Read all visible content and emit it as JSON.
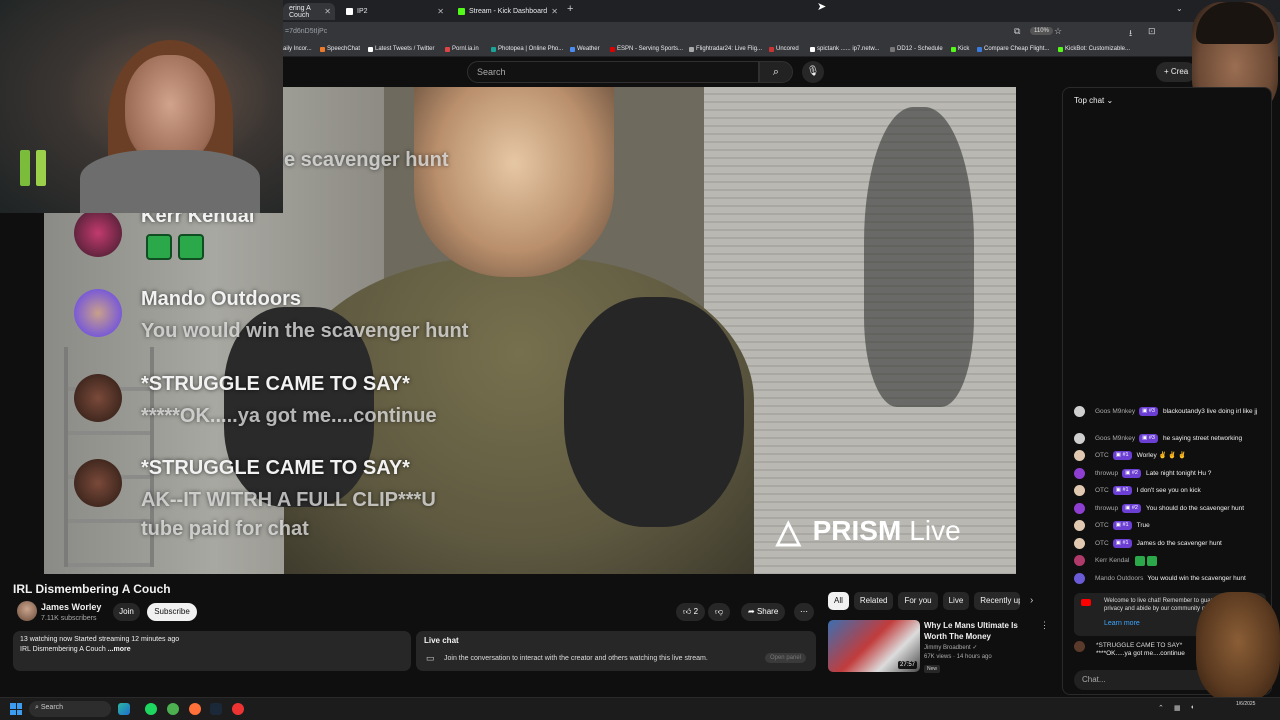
{
  "browser": {
    "tabs": [
      {
        "label": "ering A Couch",
        "active": true
      },
      {
        "label": "IP2",
        "active": false
      },
      {
        "label": "Stream - Kick Dashboard",
        "active": false
      }
    ],
    "url_fragment": "=7d6nD5tIjPc",
    "zoom": "110%",
    "bookmarks": [
      "aily Incor...",
      "SpeechChat",
      "Latest Tweets / Twitter",
      "Pornl.ia.in",
      "Photopea | Online Pho...",
      "Weather",
      "ESPN - Serving Sports...",
      "Flightradar24: Live Flig...",
      "Uncored",
      "spictank ...... ip7.netw...",
      "DD12 - Schedule",
      "Kick",
      "Compare Cheap Flight...",
      "KickBot: Customizable..."
    ]
  },
  "youtube": {
    "search_placeholder": "Search",
    "create_label": "+ Crea"
  },
  "video_overlay": {
    "scavenger_fragment": "e scavenger hunt",
    "messages": [
      {
        "name": "Kerr Kendal",
        "text": ""
      },
      {
        "name": "Mando Outdoors",
        "text": "You would win the scavenger hunt"
      },
      {
        "name": "*STRUGGLE CAME TO SAY*",
        "text": "*****OK.....ya got me....continue"
      },
      {
        "name": "*STRUGGLE CAME TO SAY*",
        "text": "AK--IT WITRH A FULL CLIP***U",
        "text2": "tube paid for chat"
      }
    ],
    "watermark": "PRISM",
    "watermark_live": "Live"
  },
  "video_info": {
    "title": "IRL Dismembering A Couch",
    "channel_name": "James Worley",
    "subscribers": "7.11K subscribers",
    "join_label": "Join",
    "subscribe_label": "Subscribe",
    "like_count": "2",
    "share_label": "Share",
    "more_label": "⋯",
    "description_line1": "13 watching now  Started streaming 12 minutes ago",
    "description_line2": "IRL Dismembering A Couch ",
    "description_more": "...more",
    "live_chat_title": "Live chat",
    "live_chat_body": "Join the conversation to interact with the creator and others watching this live stream.",
    "open_panel_label": "Open panel"
  },
  "recommendations": {
    "chips": [
      "All",
      "Related",
      "For you",
      "Live",
      "Recently up"
    ],
    "items": [
      {
        "title": "Why Le Mans Ultimate Is Worth The Money",
        "channel": "Jimmy Broadbent",
        "meta": "67K views · 14 hours ago",
        "badge": "New",
        "duration": "27:57"
      }
    ]
  },
  "chat": {
    "header": "Top chat",
    "messages": [
      {
        "author": "Goos M9nkey",
        "badge": "#3",
        "text": "blackoutandy3 live doing irl like jj",
        "avatar_color": "#cfcfcf"
      },
      {
        "author": "Goos M9nkey",
        "badge": "#3",
        "text": "he saying street networking",
        "avatar_color": "#cfcfcf"
      },
      {
        "author": "OTC",
        "badge": "#1",
        "text": "Worley ✌ ✌ ✌",
        "avatar_color": "#e0c9b0"
      },
      {
        "author": "throwup",
        "badge": "#2",
        "text": "Late night tonight Hu ?",
        "avatar_color": "#8e3fd1"
      },
      {
        "author": "OTC",
        "badge": "#1",
        "text": "I don't see you on kick",
        "avatar_color": "#e0c9b0"
      },
      {
        "author": "throwup",
        "badge": "#2",
        "text": "You should do the scavenger hunt",
        "avatar_color": "#8e3fd1"
      },
      {
        "author": "OTC",
        "badge": "#1",
        "text": "True",
        "avatar_color": "#e0c9b0"
      },
      {
        "author": "OTC",
        "badge": "#1",
        "text": "James do the scavenger hunt",
        "avatar_color": "#e0c9b0"
      },
      {
        "author": "Kerr Kendal",
        "badge": "",
        "text": "",
        "avatar_color": "#b03a6a"
      },
      {
        "author": "Mando Outdoors",
        "badge": "",
        "text": "You would win the scavenger hunt",
        "avatar_color": "#6b5bd6"
      }
    ],
    "welcome_text": "Welcome to live chat! Remember to guard your privacy and abide by our community guidelines.",
    "learn_more": "Learn more",
    "pinned_author": "*STRUGGLE CAME TO SAY*",
    "pinned_text": "****OK.....ya got me....continue",
    "input_placeholder": "Chat..."
  },
  "taskbar": {
    "search_label": "Search",
    "date": "1/6/2025"
  },
  "colors": {
    "background": "#0f0f0f",
    "subscribe_bg": "#f1f1f1",
    "badge_purple": "#6b3fd4",
    "link_blue": "#3ea6ff",
    "youtube_red": "#ff0000"
  }
}
